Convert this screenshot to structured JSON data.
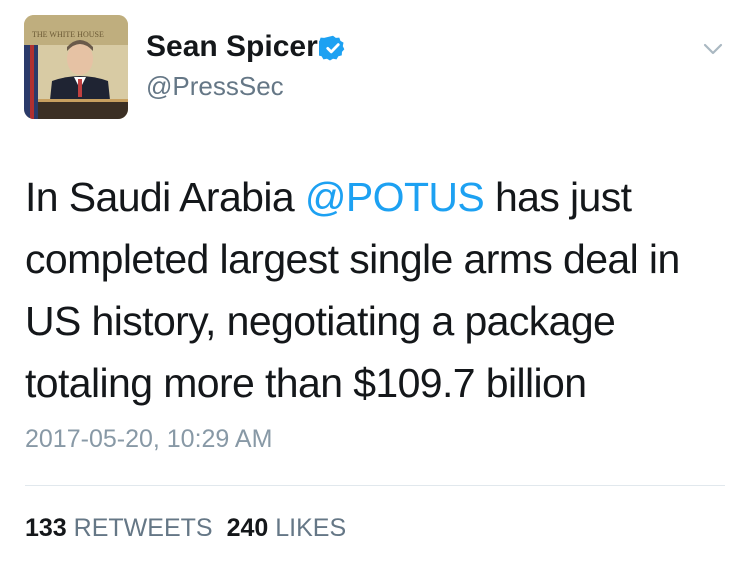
{
  "author": {
    "name": "Sean Spicer",
    "handle": "@PressSec",
    "avatar_icon": "avatar-photo",
    "verified_icon": "verified-badge-icon"
  },
  "tweet": {
    "text_before": "In Saudi Arabia ",
    "mention": "@POTUS",
    "text_after": " has just completed largest single arms deal in US history, negotiating a package totaling more than $109.7 billion",
    "timestamp": "2017-05-20, 10:29 AM"
  },
  "stats": {
    "retweets_count": "133",
    "retweets_label": "RETWEETS",
    "likes_count": "240",
    "likes_label": "LIKES"
  },
  "colors": {
    "link": "#1da1f2",
    "verified": "#1da1f2",
    "muted": "#657786"
  }
}
